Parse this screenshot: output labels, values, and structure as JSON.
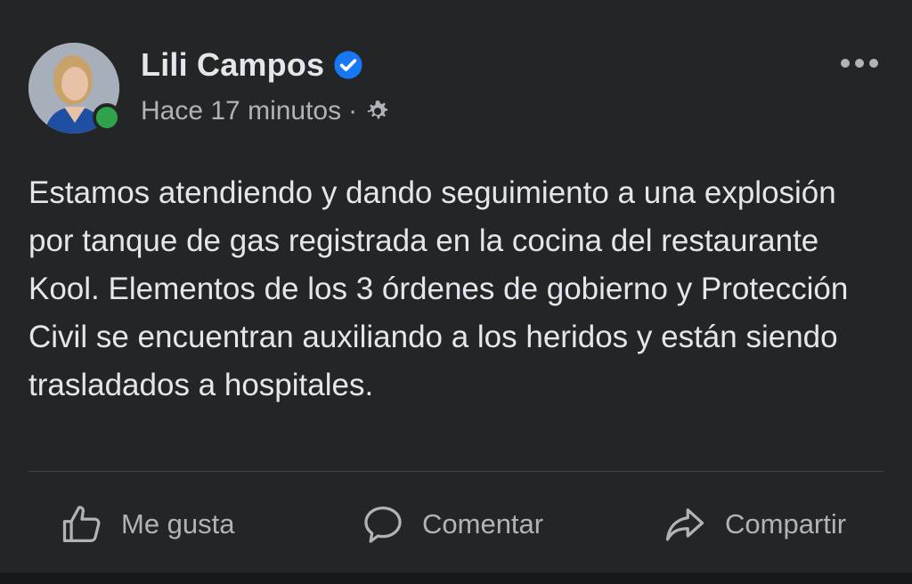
{
  "post": {
    "author": {
      "name": "Lili Campos",
      "verified_icon": "verified-badge-icon",
      "online": true
    },
    "timestamp": "Hace 17 minutos",
    "separator": "·",
    "audience_icon": "gear-icon",
    "more_icon": "more-options-icon",
    "text": "Estamos atendiendo y dando seguimiento a una explosión por tanque de gas registrada en la cocina del restaurante Kool. Elementos de los 3 órdenes de gobierno y Protección Civil se encuentran auxiliando a los heridos y están siendo trasladados a hospitales."
  },
  "actions": {
    "like_label": "Me gusta",
    "comment_label": "Comentar",
    "share_label": "Compartir"
  },
  "colors": {
    "background": "#242526",
    "text_primary": "#e4e6eb",
    "text_secondary": "#b0b3b8",
    "verified_blue": "#1877f2",
    "online_green": "#31a24c"
  }
}
